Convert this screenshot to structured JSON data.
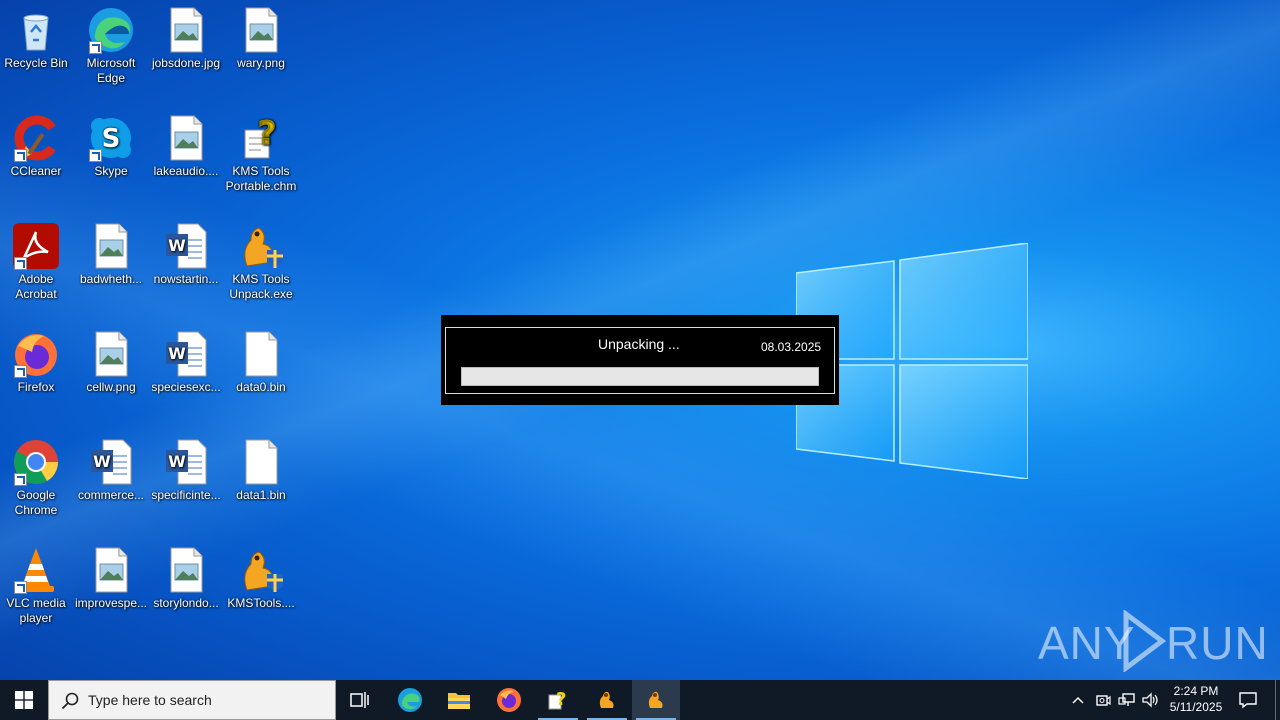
{
  "desktop": {
    "icons": [
      {
        "label": "Recycle Bin",
        "icon": "recycle-bin-icon"
      },
      {
        "label": "Microsoft Edge",
        "icon": "edge-icon"
      },
      {
        "label": "jobsdone.jpg",
        "icon": "image-file-icon"
      },
      {
        "label": "wary.png",
        "icon": "image-file-icon"
      },
      {
        "label": "CCleaner",
        "icon": "ccleaner-icon"
      },
      {
        "label": "Skype",
        "icon": "skype-icon"
      },
      {
        "label": "lakeaudio....",
        "icon": "image-file-icon"
      },
      {
        "label": "KMS Tools Portable.chm",
        "icon": "chm-help-icon"
      },
      {
        "label": "Adobe Acrobat",
        "icon": "acrobat-icon"
      },
      {
        "label": "badwheth...",
        "icon": "image-file-icon"
      },
      {
        "label": "nowstartin...",
        "icon": "word-doc-icon"
      },
      {
        "label": "KMS Tools Unpack.exe",
        "icon": "kms-tools-icon"
      },
      {
        "label": "Firefox",
        "icon": "firefox-icon"
      },
      {
        "label": "cellw.png",
        "icon": "image-file-icon"
      },
      {
        "label": "speciesexc...",
        "icon": "word-doc-icon"
      },
      {
        "label": "data0.bin",
        "icon": "blank-file-icon"
      },
      {
        "label": "Google Chrome",
        "icon": "chrome-icon"
      },
      {
        "label": "commerce...",
        "icon": "word-doc-icon"
      },
      {
        "label": "specificinte...",
        "icon": "word-doc-icon"
      },
      {
        "label": "data1.bin",
        "icon": "blank-file-icon"
      },
      {
        "label": "VLC media player",
        "icon": "vlc-icon"
      },
      {
        "label": "improvespe...",
        "icon": "image-file-icon"
      },
      {
        "label": "storylondo...",
        "icon": "image-file-icon"
      },
      {
        "label": "KMSTools....",
        "icon": "kms-tools-icon"
      }
    ]
  },
  "dialog": {
    "title": "Unpacking ...",
    "date": "08.03.2025",
    "progress": 0
  },
  "watermark": {
    "left": "ANY",
    "right": "RUN"
  },
  "taskbar": {
    "search_placeholder": "Type here to search",
    "time": "2:24 PM",
    "date": "5/11/2025"
  }
}
